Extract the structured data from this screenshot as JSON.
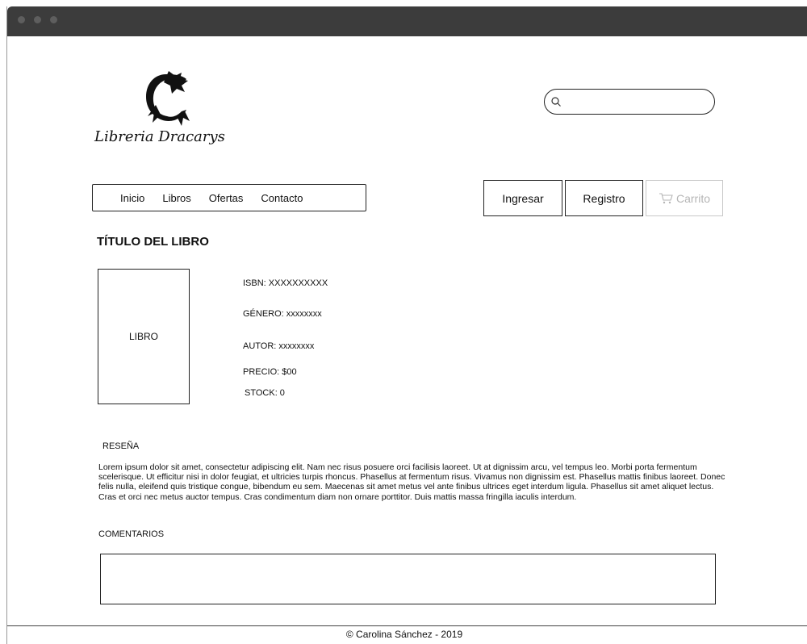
{
  "window": {
    "controls": [
      "close-dot",
      "minimize-dot",
      "maximize-dot"
    ]
  },
  "logo": {
    "text": "Libreria Dracarys",
    "icon": "dragon-icon"
  },
  "search": {
    "placeholder": "",
    "value": "",
    "icon": "search-icon"
  },
  "nav": {
    "items": [
      "Inicio",
      "Libros",
      "Ofertas",
      "Contacto"
    ]
  },
  "account": {
    "login_label": "Ingresar",
    "register_label": "Registro",
    "cart_label": "Carrito",
    "cart_icon": "cart-icon"
  },
  "book": {
    "title": "TÍTULO DEL LIBRO",
    "cover_label": "LIBRO",
    "isbn": "ISBN: XXXXXXXXXX",
    "genre": "GÉNERO: xxxxxxxx",
    "author": "AUTOR: xxxxxxxx",
    "price": "PRECIO: $00",
    "stock": "STOCK: 0"
  },
  "review": {
    "label": "RESEÑA",
    "text": "Lorem ipsum dolor sit amet, consectetur adipiscing elit. Nam nec risus posuere orci facilisis laoreet. Ut at dignissim arcu, vel tempus leo. Morbi porta fermentum scelerisque. Ut efficitur nisi in dolor feugiat, et ultricies turpis rhoncus. Phasellus at fermentum risus. Vivamus non dignissim est. Phasellus mattis finibus laoreet. Donec felis nulla, eleifend quis tristique congue, bibendum eu sem. Maecenas sit amet metus vel ante finibus ultrices eget interdum ligula. Phasellus sit amet aliquet lectus. Cras et orci nec metus auctor tempus. Cras condimentum diam non ornare porttitor. Duis mattis massa fringilla iaculis interdum."
  },
  "comments": {
    "label": "COMENTARIOS",
    "value": ""
  },
  "footer": {
    "text": "© Carolina Sánchez - 2019"
  },
  "colors": {
    "titlebar": "#3c3c3c",
    "border": "#222222",
    "disabled": "#b5b5b5"
  }
}
